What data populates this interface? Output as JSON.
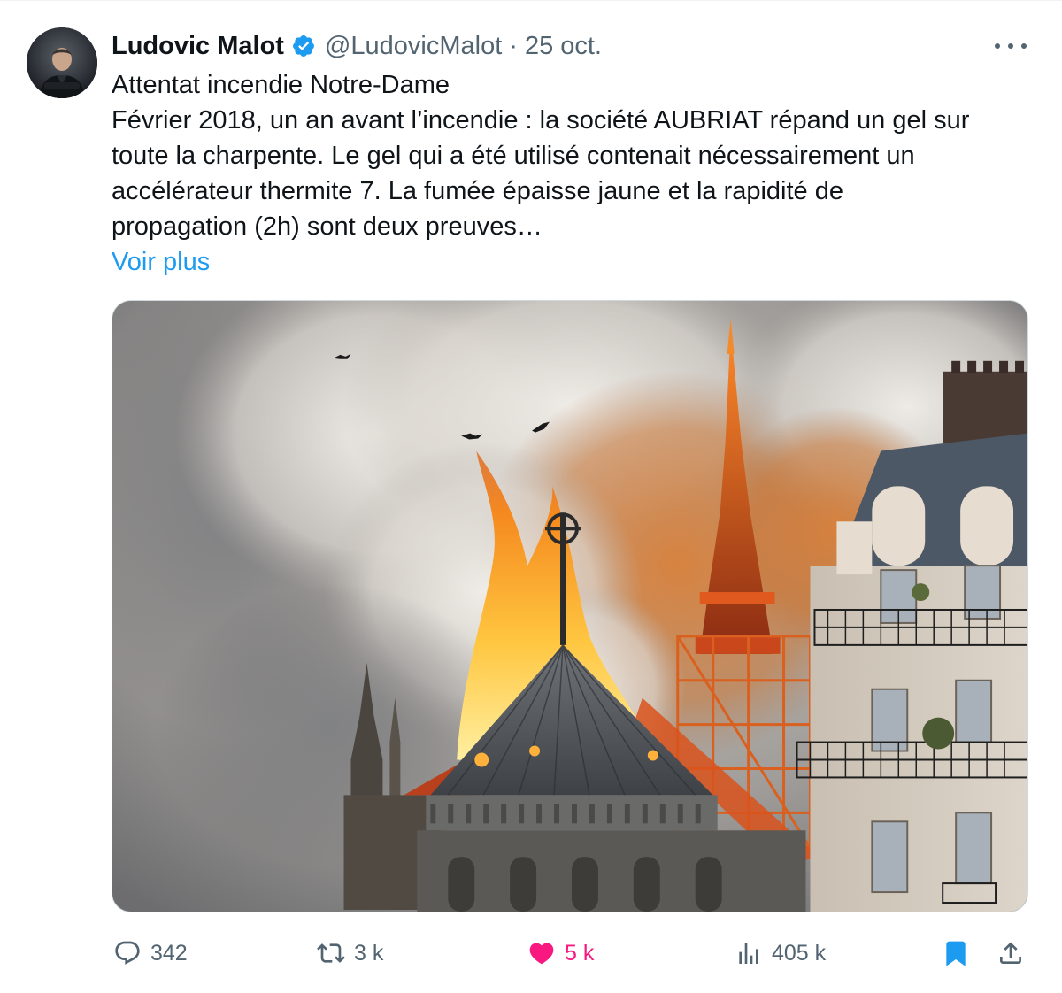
{
  "author": {
    "display_name": "Ludovic Malot",
    "handle": "@LudovicMalot",
    "separator": "·",
    "date": "25 oct.",
    "verified": true,
    "verified_color": "#1d9bf0"
  },
  "tweet": {
    "lines": [
      "Attentat incendie Notre-Dame",
      "Février 2018, un an avant l’incendie : la société AUBRIAT répand un gel sur",
      "toute la charpente. Le gel qui a été utilisé contenait nécessairement un",
      "accélérateur thermite 7. La fumée épaisse jaune et la rapidité de",
      "propagation (2h) sont deux preuves…"
    ],
    "show_more": "Voir plus"
  },
  "media": {
    "icon": "photo-notre-dame-fire"
  },
  "actions": {
    "reply": {
      "icon": "reply-icon",
      "count": "342"
    },
    "retweet": {
      "icon": "retweet-icon",
      "count": "3 k"
    },
    "like": {
      "icon": "heart-filled-icon",
      "count": "5 k",
      "color": "#f91880"
    },
    "views": {
      "icon": "views-icon",
      "count": "405 k"
    },
    "bookmark": {
      "icon": "bookmark-filled-icon",
      "color": "#1d9bf0"
    },
    "share": {
      "icon": "share-icon"
    }
  },
  "colors": {
    "text": "#0f1419",
    "secondary": "#536471",
    "link": "#1d9bf0"
  }
}
